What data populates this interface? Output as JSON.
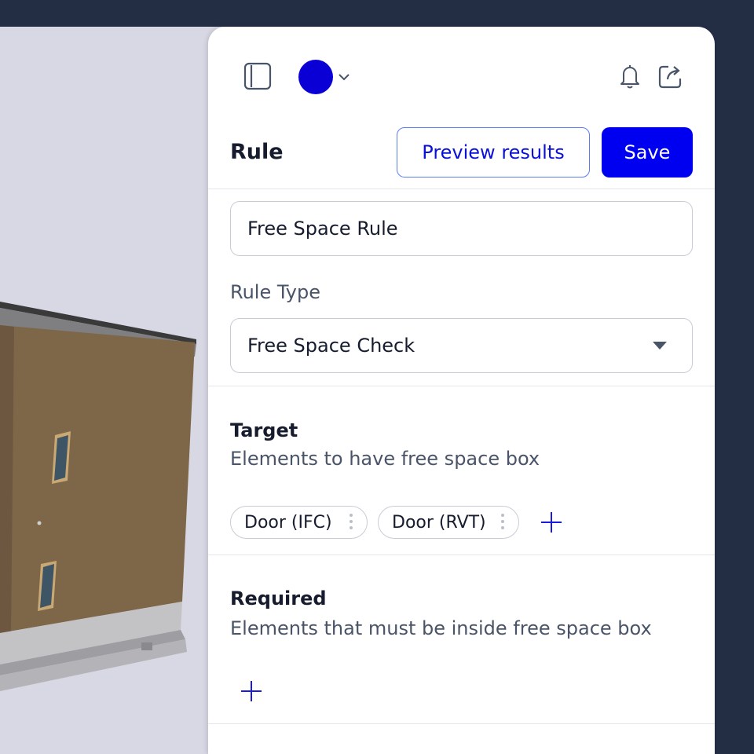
{
  "header": {
    "sidebar_icon": "sidebar-toggle-icon",
    "avatar_color": "#0a00d6",
    "bell_icon": "bell-icon",
    "share_icon": "share-icon"
  },
  "rule": {
    "title": "Rule",
    "preview_label": "Preview results",
    "save_label": "Save",
    "name_value": "Free Space Rule",
    "type_label": "Rule Type",
    "type_value": "Free Space Check"
  },
  "target": {
    "title": "Target",
    "description": "Elements to have free space box",
    "chips": [
      "Door (IFC)",
      "Door (RVT)"
    ]
  },
  "required": {
    "title": "Required",
    "description": "Elements that must be inside free space box"
  },
  "colors": {
    "accent": "#0000f0",
    "background": "#232d44"
  }
}
